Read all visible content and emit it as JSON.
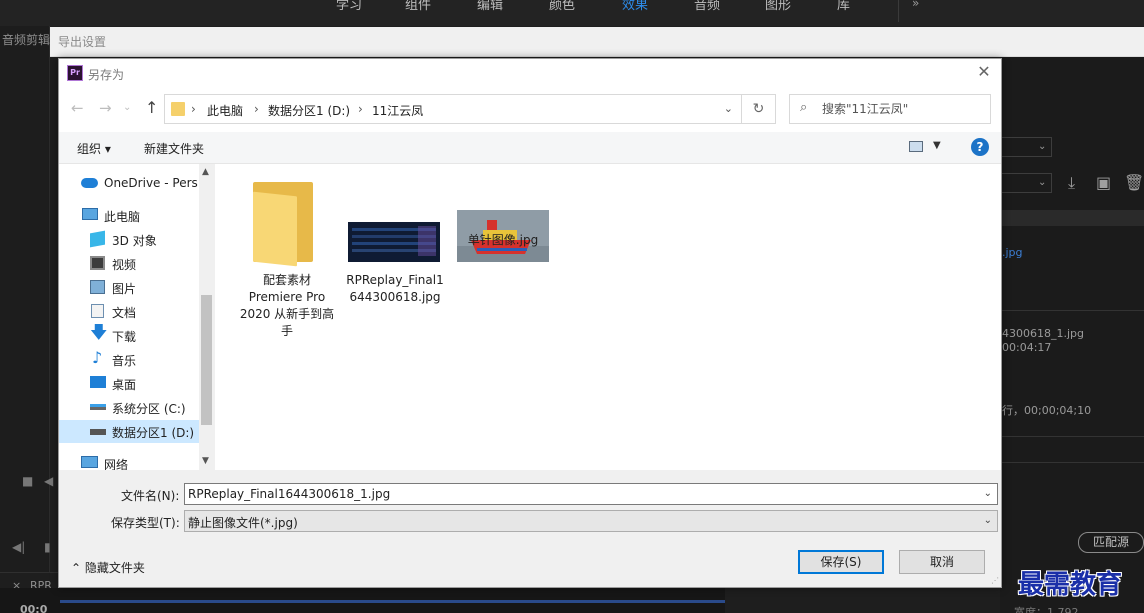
{
  "premiere": {
    "menus": [
      "学习",
      "组件",
      "编辑",
      "颜色",
      "效果",
      "音频",
      "图形",
      "库"
    ],
    "active_menu": "效果",
    "left_panel_label": "音频剪辑",
    "right_panel": {
      "file_ext": ".jpg",
      "file_name": "4300618_1.jpg",
      "timecode": "00:04:17",
      "row_text": "行，00;00;04;10",
      "match_button": "匹配源",
      "bottom_label": "宽度：1,792"
    },
    "bottom_tab": "RPR",
    "bottom_timecode": "00:0"
  },
  "export_window": {
    "title": "导出设置"
  },
  "dialog": {
    "title": "另存为",
    "app_icon_label": "Pr",
    "address": {
      "crumbs": [
        "此电脑",
        "数据分区1 (D:)",
        "11江云凤"
      ]
    },
    "search": {
      "placeholder": "搜索\"11江云凤\""
    },
    "toolbar": {
      "organize": "组织 ▾",
      "new_folder": "新建文件夹"
    },
    "nav_items": [
      {
        "label": "OneDrive - Pers",
        "icon": "onedrive-icon"
      },
      {
        "label": "此电脑",
        "icon": "computer-icon"
      },
      {
        "label": "3D 对象",
        "icon": "3d-objects-icon"
      },
      {
        "label": "视频",
        "icon": "video-icon"
      },
      {
        "label": "图片",
        "icon": "pictures-icon"
      },
      {
        "label": "文档",
        "icon": "documents-icon"
      },
      {
        "label": "下载",
        "icon": "download-icon"
      },
      {
        "label": "音乐",
        "icon": "music-icon"
      },
      {
        "label": "桌面",
        "icon": "desktop-icon"
      },
      {
        "label": "系统分区 (C:)",
        "icon": "drive-c-icon"
      },
      {
        "label": "数据分区1 (D:)",
        "icon": "drive-d-icon",
        "selected": true
      },
      {
        "label": "网络",
        "icon": "network-icon"
      }
    ],
    "files": [
      {
        "name_lines": [
          "配套素材",
          "Premiere Pro",
          "2020 从新手到高",
          "手"
        ],
        "type": "folder"
      },
      {
        "name_lines": [
          "RPReplay_Final1",
          "644300618.jpg"
        ],
        "type": "image"
      },
      {
        "name_lines": [
          "单针图像.jpg"
        ],
        "type": "image"
      }
    ],
    "form": {
      "filename_label": "文件名(N):",
      "filename_value": "RPReplay_Final1644300618_1.jpg",
      "filetype_label": "保存类型(T):",
      "filetype_value": "静止图像文件(*.jpg)",
      "hide_folders": "隐藏文件夹",
      "save_button": "保存(S)",
      "cancel_button": "取消"
    }
  },
  "watermark": "最需教育",
  "colors": {
    "accent": "#0078d7",
    "premiere_active": "#2d8ceb",
    "watermark": "#1a2fa8"
  }
}
